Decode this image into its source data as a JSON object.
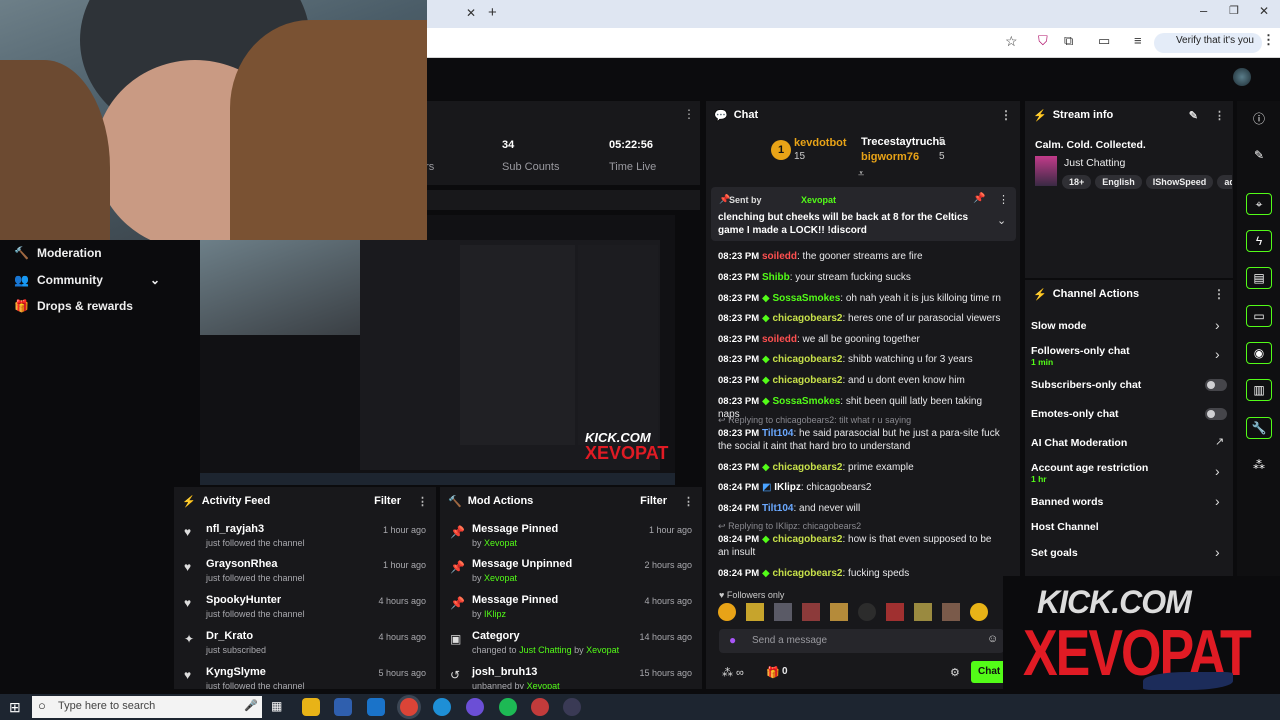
{
  "browser": {
    "verify_label": "Verify that it's you"
  },
  "sidebar": {
    "items": [
      {
        "label": "Moderation"
      },
      {
        "label": "Community"
      },
      {
        "label": "Drops & rewards"
      }
    ]
  },
  "stats": {
    "partial_label": "ers",
    "sub_counts_value": "34",
    "sub_counts_label": "Sub Counts",
    "time_live_value": "05:22:56",
    "time_live_label": "Time Live"
  },
  "activity": {
    "title": "Activity Feed",
    "filter": "Filter",
    "rows": [
      {
        "name": "nfl_rayjah3",
        "sub": "just followed the channel",
        "time": "1 hour ago"
      },
      {
        "name": "GraysonRhea",
        "sub": "just followed the channel",
        "time": "1 hour ago"
      },
      {
        "name": "SpookyHunter",
        "sub": "just followed the channel",
        "time": "4 hours ago"
      },
      {
        "name": "Dr_Krato",
        "sub": "just subscribed",
        "time": "4 hours ago"
      },
      {
        "name": "KyngSlyme",
        "sub": "just followed the channel",
        "time": "5 hours ago"
      }
    ]
  },
  "mod_actions": {
    "title": "Mod Actions",
    "filter": "Filter",
    "rows": [
      {
        "name": "Message Pinned",
        "by": "by",
        "user": "Xevopat",
        "time": "1 hour ago"
      },
      {
        "name": "Message Unpinned",
        "by": "by",
        "user": "Xevopat",
        "time": "2 hours ago"
      },
      {
        "name": "Message Pinned",
        "by": "by",
        "user": "IKlipz",
        "time": "4 hours ago"
      },
      {
        "name": "Category",
        "by": "changed to",
        "cat": "Just Chatting",
        "by2": "by",
        "user": "Xevopat",
        "time": "14 hours ago"
      },
      {
        "name": "josh_bruh13",
        "by": "unbanned by",
        "user": "Xevopat",
        "time": "15 hours ago"
      }
    ]
  },
  "chat": {
    "title": "Chat",
    "leaders": [
      {
        "rank": "1",
        "name": "kevdotbot",
        "count": "15"
      },
      {
        "name": "Trecestaytrucha",
        "count": "5"
      },
      {
        "name": "bigworm76",
        "count": "5"
      }
    ],
    "pinned": {
      "sent_by": "Sent by",
      "user": "Xevopat",
      "text": "clenching but cheeks will be back at 8 for the Celtics game I made a LOCK!! !discord"
    },
    "messages": [
      {
        "time": "08:23 PM",
        "user": "soiledd",
        "text": ": the gooner streams are fire",
        "color": "#ff5050"
      },
      {
        "time": "08:23 PM",
        "user": "Shibb",
        "text": ": your stream fucking sucks",
        "color": "#53fc18"
      },
      {
        "time": "08:23 PM",
        "user": "SossaSmokes",
        "text": ": oh nah yeah it is jus killoing time rn",
        "color": "#53fc18"
      },
      {
        "time": "08:23 PM",
        "user": "chicagobears2",
        "text": ": heres one of ur parasocial viewers",
        "color": "#c7e04a"
      },
      {
        "time": "08:23 PM",
        "user": "soiledd",
        "text": ": we all be gooning together",
        "color": "#ff5050"
      },
      {
        "time": "08:23 PM",
        "user": "chicagobears2",
        "text": ": shibb watching u for 3 years",
        "color": "#c7e04a"
      },
      {
        "time": "08:23 PM",
        "user": "chicagobears2",
        "text": ": and u dont even know him",
        "color": "#c7e04a"
      },
      {
        "time": "08:23 PM",
        "user": "SossaSmokes",
        "text": ": shit been quill latly been taking naps",
        "color": "#53fc18"
      }
    ],
    "reply1": "Replying to chicagobears2: tilt what r u saying",
    "msg_tilt1": {
      "time": "08:23 PM",
      "user": "Tilt104",
      "text": ": he said parasocial but he just a para-site fuck the social it aint that hard bro to understand"
    },
    "msg_prime": {
      "time": "08:23 PM",
      "user": "chicagobears2",
      "text": ": prime example"
    },
    "msg_iklipz": {
      "time": "08:24 PM",
      "user": "IKlipz",
      "text": ": chicagobears2"
    },
    "msg_tilt2": {
      "time": "08:24 PM",
      "user": "Tilt104",
      "text": ": and never will"
    },
    "reply2": "Replying to IKlipz: chicagobears2",
    "msg_insult": {
      "time": "08:24 PM",
      "user": "chicagobears2",
      "text": ": how is that even supposed to be an insult"
    },
    "msg_speds": {
      "time": "08:24 PM",
      "user": "chicagobears2",
      "text": ": fucking speds"
    },
    "followers_only": "Followers only",
    "input_placeholder": "Send a message",
    "points": "0",
    "send_label": "Chat"
  },
  "stream_info": {
    "title": "Stream info",
    "stream_title": "Calm. Cold. Collected.",
    "category": "Just Chatting",
    "tags": [
      "18+",
      "English",
      "IShowSpeed",
      "adin"
    ]
  },
  "channel_actions": {
    "title": "Channel Actions",
    "items": [
      {
        "label": "Slow mode"
      },
      {
        "label": "Followers-only chat",
        "sub": "1 min"
      },
      {
        "label": "Subscribers-only chat"
      },
      {
        "label": "Emotes-only chat"
      },
      {
        "label": "AI Chat Moderation"
      },
      {
        "label": "Account age restriction",
        "sub": "1 hr"
      },
      {
        "label": "Banned words"
      },
      {
        "label": "Host Channel"
      },
      {
        "label": "Set goals"
      }
    ]
  },
  "overlay": {
    "line1": "KICK.COM",
    "line2": "XEVOPAT"
  },
  "taskbar": {
    "search_placeholder": "Type here to search"
  },
  "colors": {
    "accent": "#53fc18",
    "panel": "#18181b",
    "background": "#0b0b0d"
  }
}
